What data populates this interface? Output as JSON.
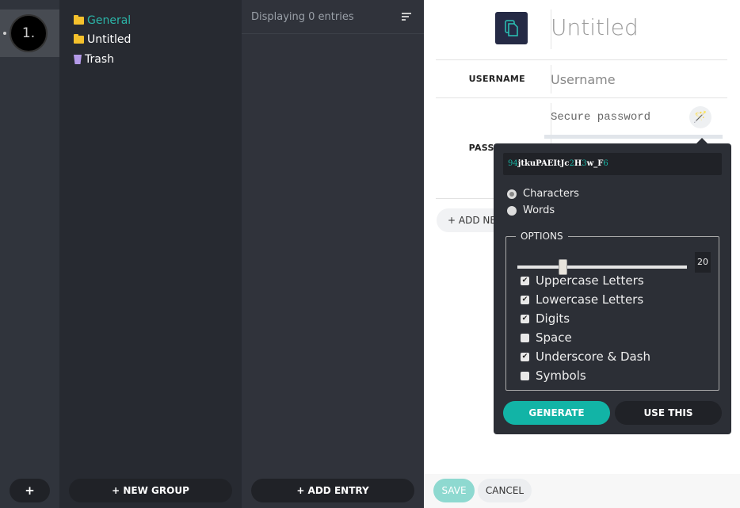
{
  "rail": {
    "archive_label": "1.",
    "add_label": "+"
  },
  "groups": {
    "items": [
      {
        "label": "General",
        "icon": "folder-icon",
        "active": true
      },
      {
        "label": "Untitled",
        "icon": "folder-icon"
      },
      {
        "label": "Trash",
        "icon": "trash-icon"
      }
    ],
    "new_group": "+ NEW GROUP"
  },
  "entries": {
    "status": "Displaying 0 entries",
    "add_entry": "+ ADD ENTRY"
  },
  "editor": {
    "title_placeholder": "Untitled",
    "username_label": "USERNAME",
    "username_placeholder": "Username",
    "password_label": "PASSWORD",
    "password_placeholder": "Secure password",
    "add_field": "+ ADD NEW FIELD",
    "save": "SAVE",
    "cancel": "CANCEL"
  },
  "generator": {
    "password_parts": [
      {
        "t": "94",
        "digit": true
      },
      {
        "t": "jtkuPAEItJc"
      },
      {
        "t": "2",
        "digit": true
      },
      {
        "t": "H"
      },
      {
        "t": "3",
        "digit": true
      },
      {
        "t": "w_F"
      },
      {
        "t": "6",
        "digit": true
      }
    ],
    "modes": [
      {
        "label": "Characters",
        "selected": true
      },
      {
        "label": "Words",
        "selected": false
      }
    ],
    "options_title": "OPTIONS",
    "length": "20",
    "options": [
      {
        "label": "Uppercase Letters",
        "checked": true
      },
      {
        "label": "Lowercase Letters",
        "checked": true
      },
      {
        "label": "Digits",
        "checked": true
      },
      {
        "label": "Space",
        "checked": false
      },
      {
        "label": "Underscore & Dash",
        "checked": true
      },
      {
        "label": "Symbols",
        "checked": false
      }
    ],
    "generate": "GENERATE",
    "use_this": "USE THIS"
  },
  "colors": {
    "accent": "#18b5a5",
    "active_group": "#2bb5a8"
  }
}
